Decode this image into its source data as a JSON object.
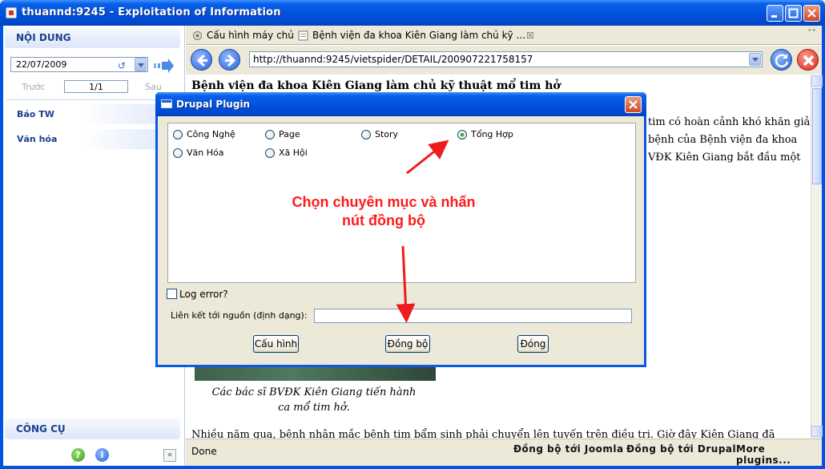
{
  "window": {
    "title": "thuannd:9245 - Exploitation of Information",
    "icon": "app-icon"
  },
  "sidebar": {
    "header": "NỘI DUNG",
    "date": "22/07/2009",
    "pager": {
      "prev": "Trước",
      "page": "1/1",
      "next": "Sau"
    },
    "categories": [
      "Báo TW",
      "Văn hóa"
    ],
    "footer": "CÔNG CỤ",
    "footer_icons": [
      "help-icon",
      "info-icon"
    ]
  },
  "tabs": [
    {
      "label": "Cấu hình máy chủ",
      "icon": "gear-icon"
    },
    {
      "label": "Bệnh viện đa khoa Kiên Giang làm chủ kỹ ...",
      "icon": "page-icon"
    }
  ],
  "navbar": {
    "url": "http://thuannd:9245/vietspider/DETAIL/200907221758157"
  },
  "content": {
    "title": "Bệnh viện đa khoa Kiên Giang làm chủ kỹ thuật mổ tim hở",
    "bg_lines": [
      "tim có hoàn cảnh khó khăn giảm",
      "bệnh của Bệnh viện đa khoa",
      "VĐK Kiên Giang bắt đầu một"
    ],
    "caption_lines": [
      "Các bác sĩ BVĐK Kiên Giang tiến hành",
      "ca mổ tim hở."
    ],
    "body_line": "Nhiều năm qua, bệnh nhân mắc bệnh tim bẩm sinh phải chuyển lên tuyến trên điều trị. Giờ đây Kiên Giang đã"
  },
  "status": {
    "text": "Done",
    "links": [
      "Đồng bộ tới Joomla",
      "Đồng bộ tới Drupal",
      "More plugins..."
    ]
  },
  "dialog": {
    "title": "Drupal Plugin",
    "options": [
      {
        "label": "Công Nghệ",
        "checked": false
      },
      {
        "label": "Page",
        "checked": false
      },
      {
        "label": "Story",
        "checked": false
      },
      {
        "label": "Tổng Hợp",
        "checked": true
      },
      {
        "label": "Văn Hóa",
        "checked": false
      },
      {
        "label": "Xã Hội",
        "checked": false
      }
    ],
    "log_error_label": "Log error?",
    "log_error_checked": false,
    "link_label": "Liên kết tới nguồn (định dạng):",
    "link_value": "",
    "buttons": {
      "config": "Cấu hình",
      "sync": "Đồng bộ",
      "close": "Đóng"
    }
  },
  "annotation": {
    "lines": [
      "Chọn chuyên mục và nhấn",
      "nút đồng bộ"
    ],
    "color": "#ff1a1a"
  },
  "colors": {
    "titlebar": "#0054E3",
    "face": "#ECE9D8",
    "sidebar_text": "#1b3f8f"
  }
}
